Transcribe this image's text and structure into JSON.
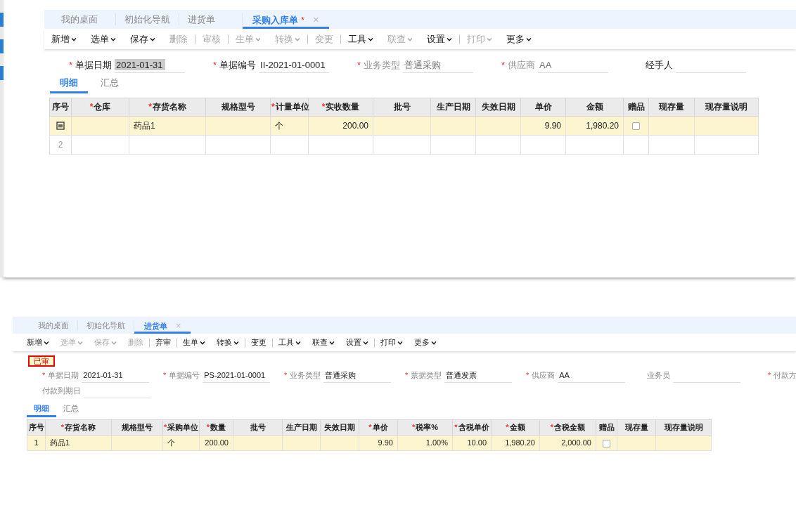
{
  "panels": [
    {
      "tabs": [
        {
          "label": "我的桌面",
          "selected": false
        },
        {
          "label": "初始化导航",
          "selected": false
        },
        {
          "label": "进货单",
          "selected": false
        },
        {
          "label": "采购入库单",
          "selected": true,
          "modified_mark": "*",
          "close": "×"
        }
      ],
      "toolbar": [
        {
          "label": "新增",
          "dropdown": true,
          "disabled": false,
          "separator": false
        },
        {
          "label": "选单",
          "dropdown": true,
          "disabled": false,
          "separator": false
        },
        {
          "label": "保存",
          "dropdown": true,
          "disabled": false,
          "separator": false
        },
        {
          "label": "删除",
          "dropdown": false,
          "disabled": true,
          "separator": true
        },
        {
          "label": "审核",
          "dropdown": false,
          "disabled": true,
          "separator": true
        },
        {
          "label": "生单",
          "dropdown": true,
          "disabled": true,
          "separator": false
        },
        {
          "label": "转换",
          "dropdown": true,
          "disabled": true,
          "separator": true
        },
        {
          "label": "变更",
          "dropdown": false,
          "disabled": true,
          "separator": true
        },
        {
          "label": "工具",
          "dropdown": true,
          "disabled": false,
          "separator": false
        },
        {
          "label": "联查",
          "dropdown": true,
          "disabled": true,
          "separator": false
        },
        {
          "label": "设置",
          "dropdown": true,
          "disabled": false,
          "separator": true
        },
        {
          "label": "打印",
          "dropdown": true,
          "disabled": true,
          "separator": false
        },
        {
          "label": "更多",
          "dropdown": true,
          "disabled": false,
          "separator": false
        }
      ],
      "field_rows": [
        [
          {
            "required_mark": "*",
            "label": "单据日期",
            "disabled": false,
            "value": "2021-01-31",
            "highlighted": true
          },
          {
            "required_mark": "*",
            "label": "单据编号",
            "disabled": false,
            "value": "II-2021-01-0001",
            "highlighted": false
          },
          {
            "required_mark": "*",
            "label": "业务类型",
            "disabled": true,
            "value": "普通采购",
            "highlighted": false
          },
          {
            "required_mark": "*",
            "label": "供应商",
            "disabled": true,
            "value": "AA",
            "highlighted": false
          },
          {
            "label": "经手人",
            "disabled": false,
            "highlighted": false
          }
        ]
      ],
      "detail_tabs": [
        {
          "label": "明细",
          "selected": true
        },
        {
          "label": "汇总",
          "selected": false
        }
      ],
      "table": {
        "columns": [
          {
            "label": "序号",
            "kind": "seq"
          },
          {
            "required_mark": "*",
            "label": "仓库",
            "kind": "text"
          },
          {
            "required_mark": "*",
            "label": "存货名称",
            "kind": "text"
          },
          {
            "label": "规格型号",
            "kind": "text"
          },
          {
            "required_mark": "*",
            "label": "计量单位",
            "kind": "text"
          },
          {
            "required_mark": "*",
            "label": "实收数量",
            "kind": "number"
          },
          {
            "label": "批号",
            "kind": "text"
          },
          {
            "label": "生产日期",
            "kind": "text"
          },
          {
            "label": "失效日期",
            "kind": "text"
          },
          {
            "label": "单价",
            "kind": "number"
          },
          {
            "label": "金额",
            "kind": "number"
          },
          {
            "label": "赠品",
            "kind": "check"
          },
          {
            "label": "现存量",
            "kind": "text"
          },
          {
            "label": "现存量说明",
            "kind": "text"
          }
        ],
        "rows": [
          {
            "selected": true,
            "editing": true,
            "cells": [
              "",
              "",
              "药品1",
              "",
              "个",
              "200.00",
              "",
              "",
              "",
              "9.90",
              "1,980.20",
              false,
              "",
              ""
            ]
          },
          {
            "selected": false,
            "editing": false,
            "cells": [
              "2",
              "",
              "",
              "",
              "",
              "",
              "",
              "",
              "",
              "",
              "",
              "",
              "",
              ""
            ]
          }
        ]
      }
    },
    {
      "tabs": [
        {
          "label": "我的桌面",
          "selected": false
        },
        {
          "label": "初始化导航",
          "selected": false
        },
        {
          "label": "进货单",
          "selected": true,
          "close": "×"
        }
      ],
      "toolbar": [
        {
          "label": "新增",
          "dropdown": true,
          "disabled": false,
          "separator": false
        },
        {
          "label": "选单",
          "dropdown": true,
          "disabled": true,
          "separator": false
        },
        {
          "label": "保存",
          "dropdown": true,
          "disabled": true,
          "separator": false
        },
        {
          "label": "删除",
          "dropdown": false,
          "disabled": true,
          "separator": true
        },
        {
          "label": "弃审",
          "dropdown": false,
          "disabled": false,
          "separator": true
        },
        {
          "label": "生单",
          "dropdown": true,
          "disabled": false,
          "separator": false
        },
        {
          "label": "转换",
          "dropdown": true,
          "disabled": false,
          "separator": true
        },
        {
          "label": "变更",
          "dropdown": false,
          "disabled": false,
          "separator": true
        },
        {
          "label": "工具",
          "dropdown": true,
          "disabled": false,
          "separator": false
        },
        {
          "label": "联查",
          "dropdown": true,
          "disabled": false,
          "separator": false
        },
        {
          "label": "设置",
          "dropdown": true,
          "disabled": false,
          "separator": true
        },
        {
          "label": "打印",
          "dropdown": true,
          "disabled": false,
          "separator": false
        },
        {
          "label": "更多",
          "dropdown": true,
          "disabled": false,
          "separator": false
        }
      ],
      "status_stamp": "已审",
      "field_rows": [
        [
          {
            "required_mark": "*",
            "label": "单据日期",
            "disabled": false,
            "value": "2021-01-31"
          },
          {
            "required_mark": "*",
            "label": "单据编号",
            "disabled": false,
            "value": "PS-2021-01-0001"
          },
          {
            "required_mark": "*",
            "label": "业务类型",
            "disabled": false,
            "value": "普通采购"
          },
          {
            "required_mark": "*",
            "label": "票据类型",
            "disabled": false,
            "value": "普通发票"
          },
          {
            "required_mark": "*",
            "label": "供应商",
            "disabled": false,
            "value": "AA"
          },
          {
            "label": "业务员",
            "disabled": false
          },
          {
            "required_mark": "*",
            "label": "付款方",
            "disabled": false,
            "cut_at_edge": true
          }
        ],
        [
          {
            "label": "付款到期日",
            "disabled": false
          }
        ]
      ],
      "detail_tabs": [
        {
          "label": "明细",
          "selected": true
        },
        {
          "label": "汇总",
          "selected": false
        }
      ],
      "table": {
        "columns": [
          {
            "label": "序号",
            "kind": "seq"
          },
          {
            "required_mark": "*",
            "label": "存货名称",
            "kind": "text"
          },
          {
            "label": "规格型号",
            "kind": "text"
          },
          {
            "required_mark": "*",
            "label": "采购单位",
            "kind": "text"
          },
          {
            "required_mark": "*",
            "label": "数量",
            "kind": "number"
          },
          {
            "label": "批号",
            "kind": "text"
          },
          {
            "label": "生产日期",
            "kind": "text"
          },
          {
            "label": "失效日期",
            "kind": "text"
          },
          {
            "required_mark": "*",
            "label": "单价",
            "kind": "number"
          },
          {
            "required_mark": "*",
            "label": "税率%",
            "kind": "number"
          },
          {
            "required_mark": "*",
            "label": "含税单价",
            "kind": "number"
          },
          {
            "required_mark": "*",
            "label": "金额",
            "kind": "number"
          },
          {
            "required_mark": "*",
            "label": "含税金额",
            "kind": "number"
          },
          {
            "label": "赠品",
            "kind": "check"
          },
          {
            "label": "现存量",
            "kind": "text"
          },
          {
            "label": "现存量说明",
            "kind": "text"
          }
        ],
        "rows": [
          {
            "selected": true,
            "editing": false,
            "cells": [
              "1",
              "药品1",
              "",
              "个",
              "200.00",
              "",
              "",
              "",
              "9.90",
              "1.00%",
              "10.00",
              "1,980.20",
              "2,000.00",
              false,
              "",
              ""
            ]
          }
        ]
      }
    }
  ]
}
